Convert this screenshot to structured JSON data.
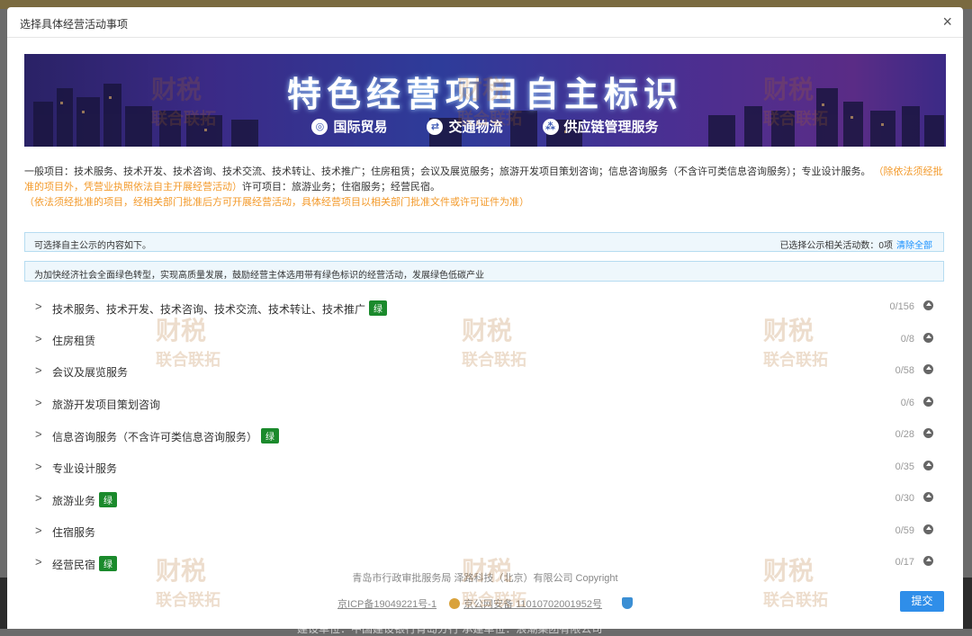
{
  "dialog": {
    "title": "选择具体经营活动事项",
    "close": "×"
  },
  "banner": {
    "title": "特色经营项目自主标识",
    "tags": [
      "国际贸易",
      "交通物流",
      "供应链管理服务"
    ]
  },
  "scope": {
    "general": "一般项目：技术服务、技术开发、技术咨询、技术交流、技术转让、技术推广；住房租赁；会议及展览服务；旅游开发项目策划咨询；信息咨询服务（不含许可类信息咨询服务）；专业设计服务。",
    "general_note": "（除依法须经批准的项目外，凭营业执照依法自主开展经营活动）",
    "licensed": "许可项目：旅游业务；住宿服务；经营民宿。",
    "licensed_note": "（依法须经批准的项目，经相关部门批准后方可开展经营活动，具体经营项目以相关部门批准文件或许可证件为准）"
  },
  "panel": {
    "left": "可选择自主公示的内容如下。",
    "selected": "已选择公示相关活动数：0项",
    "clear": "清除全部"
  },
  "notice": "为加快经济社会全面绿色转型，实现高质量发展，鼓励经营主体选用带有绿色标识的经营活动，发展绿色低碳产业",
  "items": [
    {
      "label": "技术服务、技术开发、技术咨询、技术交流、技术转让、技术推广",
      "badge": "绿",
      "count": "0/156"
    },
    {
      "label": "住房租赁",
      "badge": "",
      "count": "0/8"
    },
    {
      "label": "会议及展览服务",
      "badge": "",
      "count": "0/58"
    },
    {
      "label": "旅游开发项目策划咨询",
      "badge": "",
      "count": "0/6"
    },
    {
      "label": "信息咨询服务（不含许可类信息咨询服务）",
      "badge": "绿",
      "count": "0/28"
    },
    {
      "label": "专业设计服务",
      "badge": "",
      "count": "0/35"
    },
    {
      "label": "旅游业务",
      "badge": "绿",
      "count": "0/30"
    },
    {
      "label": "住宿服务",
      "badge": "",
      "count": "0/59"
    },
    {
      "label": "经营民宿",
      "badge": "绿",
      "count": "0/17"
    }
  ],
  "footer": {
    "line1": "青岛市行政审批服务局   泽路科技（北京）有限公司   Copyright",
    "icp": "京ICP备19049221号-1",
    "police": "京公网安备 11010702001952号"
  },
  "submit": "提交",
  "backdrop_text": "建设单位：中国建设银行青岛分行    承建单位：浪潮集团有限公司",
  "watermark": {
    "line1": "财税",
    "line2": "联合联拓"
  }
}
